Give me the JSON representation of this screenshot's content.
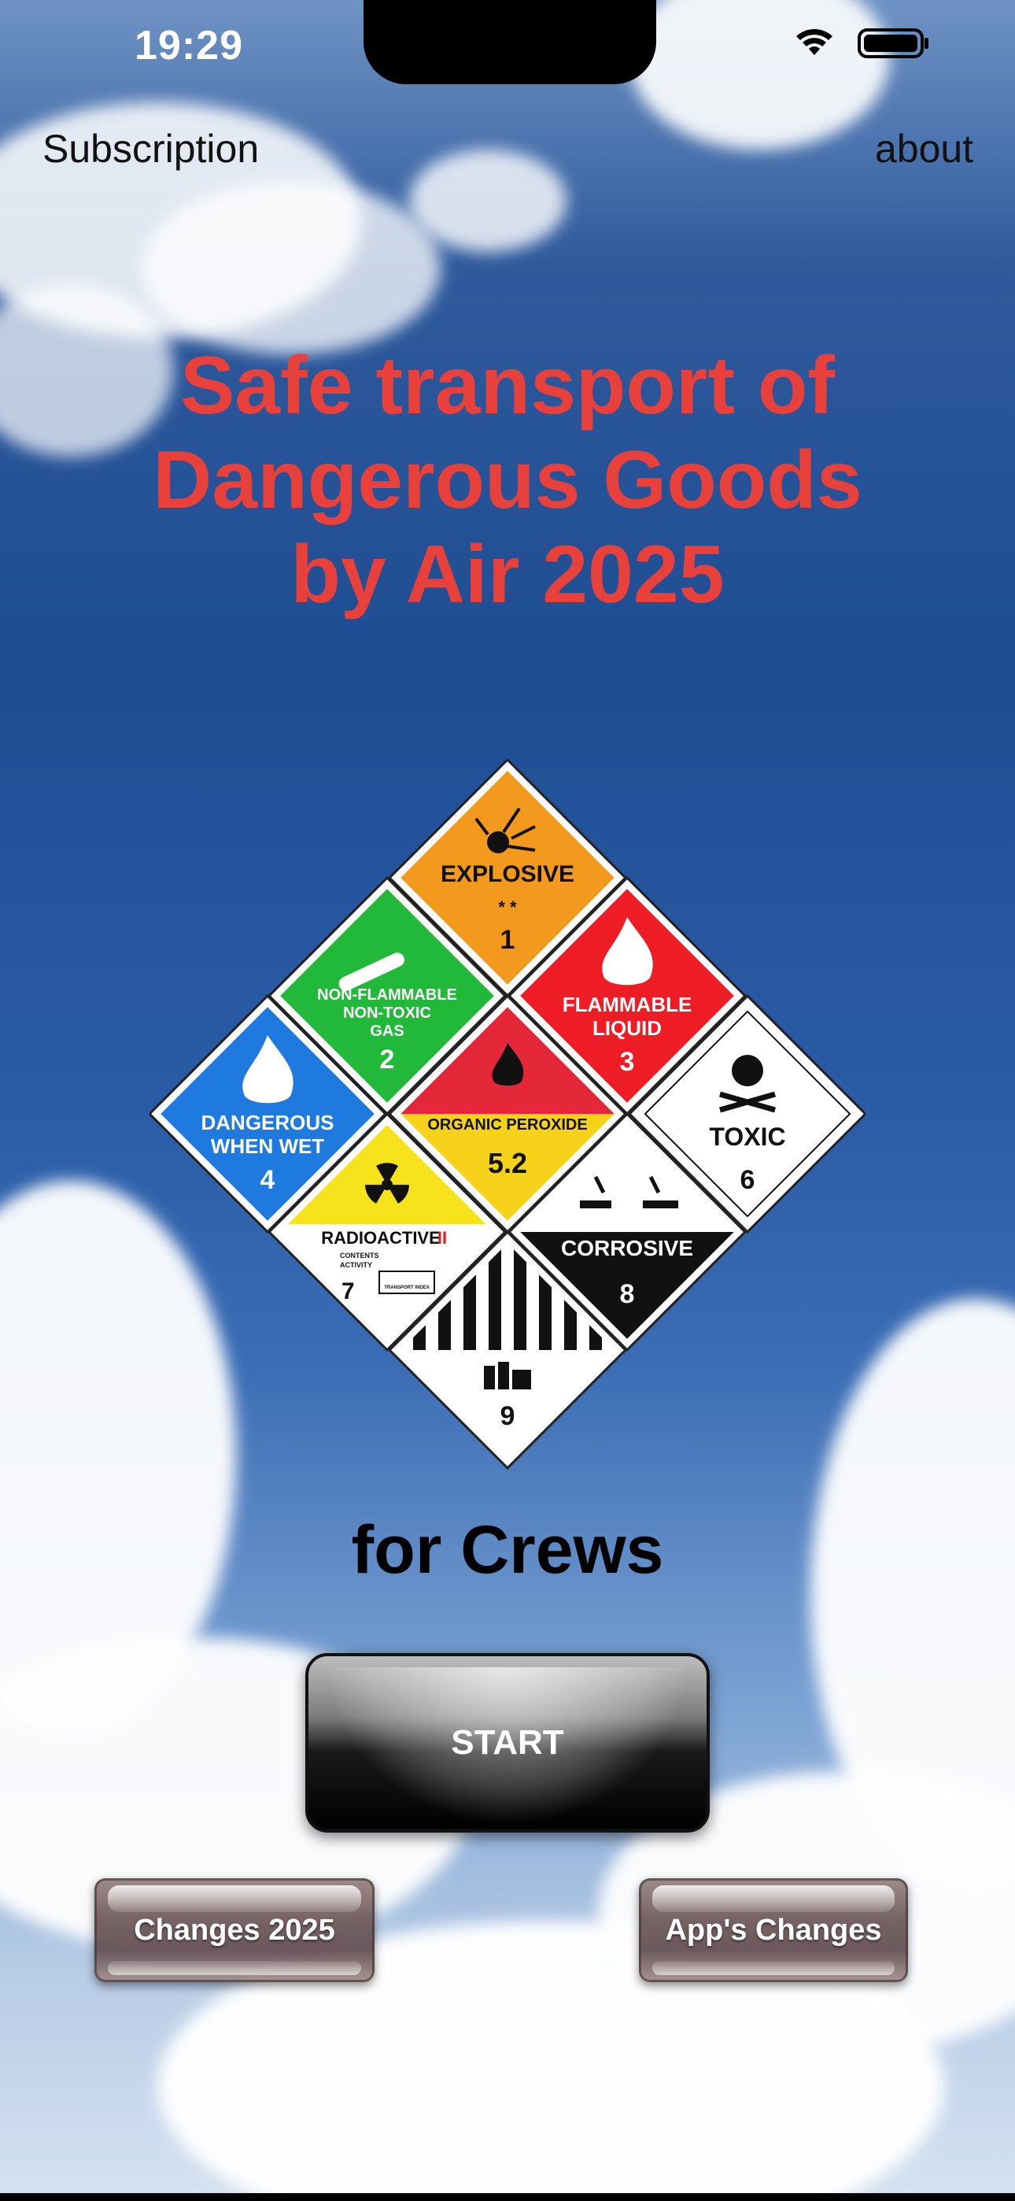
{
  "status_bar": {
    "time": "19:29"
  },
  "nav": {
    "left": "Subscription",
    "right": "about"
  },
  "title_lines": [
    "Safe transport of",
    "Dangerous Goods",
    "by Air 2025"
  ],
  "placards": {
    "explosive": {
      "label": "EXPLOSIVE",
      "stars": "* *",
      "num": "1",
      "color": "#f39a1e"
    },
    "gas": {
      "line1": "NON-FLAMMABLE",
      "line2": "NON-TOXIC",
      "line3": "GAS",
      "num": "2",
      "color": "#22b83a"
    },
    "flammable": {
      "line1": "FLAMMABLE",
      "line2": "LIQUID",
      "num": "3",
      "color": "#ee1c24"
    },
    "wet": {
      "line1": "DANGEROUS",
      "line2": "WHEN WET",
      "num": "4",
      "color": "#1f7ae0"
    },
    "peroxide": {
      "label": "ORGANIC PEROXIDE",
      "num": "5.2",
      "top": "#e4283a",
      "bottom": "#f7d21b"
    },
    "toxic": {
      "label": "TOXIC",
      "num": "6"
    },
    "radioactive": {
      "label": "RADIOACTIVE",
      "roman": "II",
      "contents": "CONTENTS",
      "activity": "ACTIVITY",
      "index": "TRANSPORT INDEX",
      "num": "7"
    },
    "corrosive": {
      "label": "CORROSIVE",
      "num": "8"
    },
    "misc": {
      "num": "9"
    }
  },
  "subtitle": "for Crews",
  "buttons": {
    "start": "START",
    "changes": "Changes 2025",
    "app_changes": "App's Changes"
  }
}
